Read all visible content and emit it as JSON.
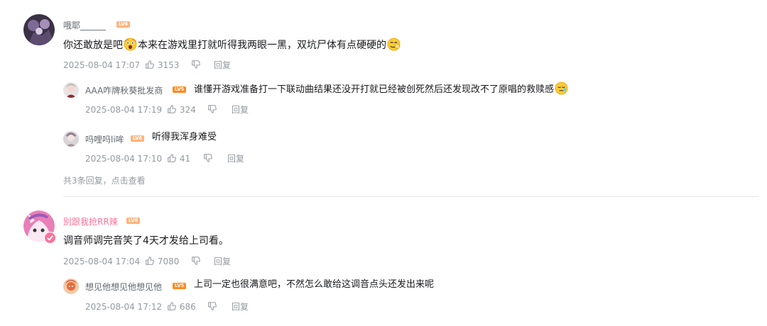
{
  "comments": [
    {
      "user": "哦耶______",
      "level": "LV6",
      "content_pre": "你还敢放是吧",
      "content_mid": "本来在游戏里打就听得我两眼一黑，双坑尸体有点硬硬的",
      "emoji_1": "scared-emoji",
      "emoji_2": "awkward-emoji",
      "date": "2025-08-04 17:07",
      "likes": "3153",
      "reply_label": "回复",
      "replies": [
        {
          "user": "AAA咋牌秋葵批发商",
          "level": "LV5",
          "content": "谁懂开游戏准备打一下联动曲结果还没开打就已经被创死然后还发现改不了原唱的救赎感",
          "emoji": "wipe-tears-emoji",
          "date": "2025-08-04 17:19",
          "likes": "324",
          "reply_label": "回复"
        },
        {
          "user": "吗哩吗li哞",
          "level": "LV6",
          "content": "听得我浑身难受",
          "date": "2025-08-04 17:10",
          "likes": "41",
          "reply_label": "回复"
        }
      ],
      "more_replies": "共3条回复，点击查看"
    },
    {
      "user": "别跟我抢RR辣",
      "level": "LV6",
      "content": "调音师调完音笑了4天才发给上司看。",
      "date": "2025-08-04 17:04",
      "likes": "7080",
      "reply_label": "回复",
      "replies": [
        {
          "user": "想见他想见他想见他",
          "level": "LV5",
          "content": "上司一定也很满意吧，不然怎么敢给这调音点头还发出来呢",
          "date": "2025-08-04 17:12",
          "likes": "686",
          "reply_label": "回复"
        }
      ]
    }
  ],
  "colors": {
    "vip_name": "#fb7299",
    "meta": "#9499a0",
    "name": "#61666d",
    "level5": "#ff8a1f",
    "level6": "#ffb37c"
  }
}
